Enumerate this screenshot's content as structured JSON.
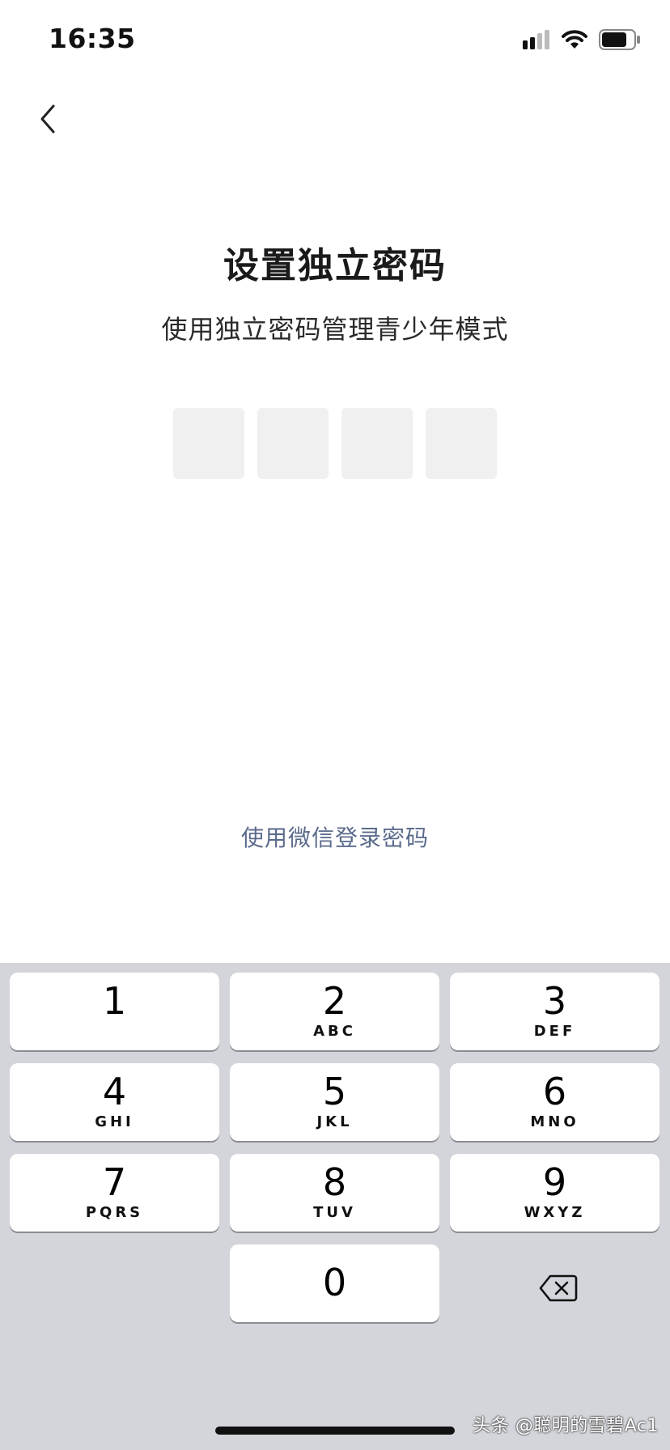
{
  "status_bar": {
    "time": "16:35",
    "icons": [
      "cellular-signal-icon",
      "wifi-icon",
      "battery-icon"
    ]
  },
  "nav": {
    "back_icon": "chevron-left-icon"
  },
  "main": {
    "title": "设置独立密码",
    "subtitle": "使用独立密码管理青少年模式",
    "pin_length": 4,
    "wechat_link": "使用微信登录密码",
    "link_color": "#5b6b8c"
  },
  "keypad": {
    "keys": [
      {
        "digit": "1",
        "letters": ""
      },
      {
        "digit": "2",
        "letters": "ABC"
      },
      {
        "digit": "3",
        "letters": "DEF"
      },
      {
        "digit": "4",
        "letters": "GHI"
      },
      {
        "digit": "5",
        "letters": "JKL"
      },
      {
        "digit": "6",
        "letters": "MNO"
      },
      {
        "digit": "7",
        "letters": "PQRS"
      },
      {
        "digit": "8",
        "letters": "TUV"
      },
      {
        "digit": "9",
        "letters": "WXYZ"
      },
      {
        "digit": "0",
        "letters": ""
      }
    ],
    "delete_icon": "backspace-icon",
    "background": "#d3d5db"
  },
  "watermark": {
    "text": "头条 @聪明的雪碧Ac1"
  }
}
